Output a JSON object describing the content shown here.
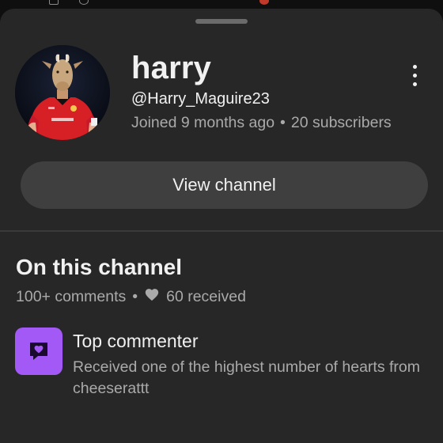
{
  "profile": {
    "display_name": "harry",
    "handle": "@Harry_Maguire23",
    "joined": "Joined 9 months ago",
    "separator": "•",
    "subscribers": "20 subscribers",
    "avatar_icon": "profile-photo"
  },
  "actions": {
    "more_icon": "more-vert-icon",
    "view_channel_label": "View channel"
  },
  "channel_section": {
    "title": "On this channel",
    "comments": "100+ comments",
    "separator": "•",
    "heart_icon": "heart-icon",
    "hearts_received": "60 received"
  },
  "badge": {
    "icon": "heart-comment-icon",
    "title": "Top commenter",
    "description": "Received one of the highest number of hearts from cheeserattt"
  },
  "colors": {
    "sheet_bg": "#272727",
    "button_bg": "#3f3f3f",
    "badge_bg": "#a259f6",
    "secondary_text": "#aaaaaa",
    "primary_text": "#f1f1f1"
  }
}
